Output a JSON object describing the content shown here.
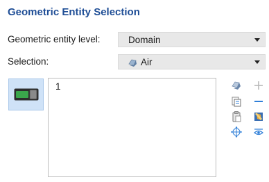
{
  "panel": {
    "title": "Geometric Entity Selection"
  },
  "entity_level": {
    "label": "Geometric entity level:",
    "selected": "Domain"
  },
  "selection": {
    "label": "Selection:",
    "selected": "Air",
    "icon": "domain-selection-icon"
  },
  "selection_list": {
    "items": [
      "1"
    ]
  },
  "tools": {
    "left": [
      "paste-selection-icon",
      "copy-selection-icon",
      "clipboard-icon",
      "zoom-to-selection-icon"
    ],
    "right": [
      "add-icon",
      "remove-icon",
      "clear-selection-icon",
      "show-selection-icon"
    ]
  },
  "colors": {
    "title": "#1f4e96",
    "accent": "#2f7fd8",
    "toggle_bg": "#cfe2f7",
    "toggle_icon": "#3aa64b"
  }
}
